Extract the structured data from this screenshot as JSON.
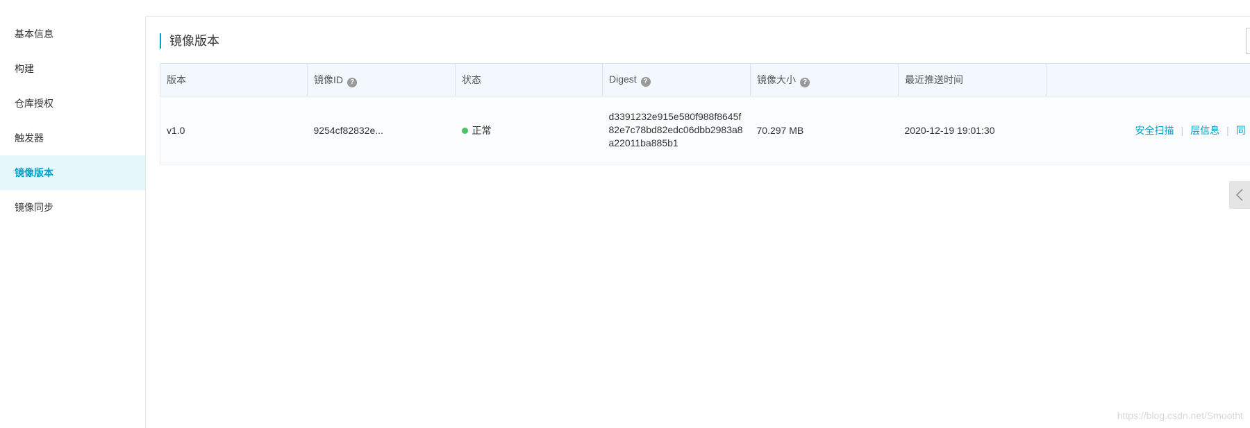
{
  "sidebar": {
    "items": [
      {
        "label": "基本信息"
      },
      {
        "label": "构建"
      },
      {
        "label": "仓库授权"
      },
      {
        "label": "触发器"
      },
      {
        "label": "镜像版本"
      },
      {
        "label": "镜像同步"
      }
    ],
    "active_index": 4
  },
  "header": {
    "section_title": "镜像版本"
  },
  "table": {
    "columns": [
      "版本",
      "镜像ID",
      "状态",
      "Digest",
      "镜像大小",
      "最近推送时间",
      ""
    ],
    "rows": [
      {
        "version": "v1.0",
        "image_id": "9254cf82832e...",
        "status": "正常",
        "digest": "d3391232e915e580f988f8645f82e7c78bd82edc06dbb2983a8a22011ba885b1",
        "size": "70.297 MB",
        "pushed_at": "2020-12-19 19:01:30",
        "actions": [
          "安全扫描",
          "层信息",
          "同"
        ]
      }
    ]
  },
  "icons": {
    "help": "help-circle-icon",
    "collapse": "chevron-left-icon"
  },
  "colors": {
    "accent": "#00a2ca",
    "status_ok": "#4cc464",
    "active_bg": "#e6f7fc"
  },
  "watermark": "https://blog.csdn.net/Smootht"
}
